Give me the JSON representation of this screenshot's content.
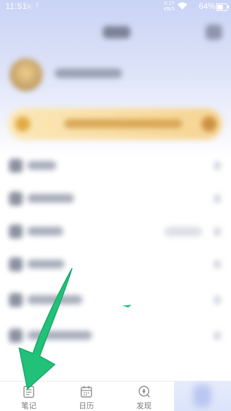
{
  "status_bar": {
    "time": "11:51",
    "network_speed_value": "0.27",
    "network_speed_unit": "KB/S",
    "battery": "64%",
    "battery_level": 0.64
  },
  "menu_rows": [
    {
      "name": "menu-row-1"
    },
    {
      "name": "menu-row-2"
    },
    {
      "name": "menu-row-3"
    },
    {
      "name": "menu-row-4"
    },
    {
      "name": "menu-row-5"
    },
    {
      "name": "menu-row-6"
    }
  ],
  "tab_bar": {
    "notes_label": "笔记",
    "calendar_label": "日历",
    "discover_label": "发现"
  },
  "colors": {
    "annotation_arrow": "#21c17a",
    "header_gradient": "#c9d3f5",
    "vip_gold": "#f6d493"
  },
  "icons": {
    "notes": "notebook-icon",
    "calendar": "calendar-icon",
    "discover": "discover-icon"
  }
}
